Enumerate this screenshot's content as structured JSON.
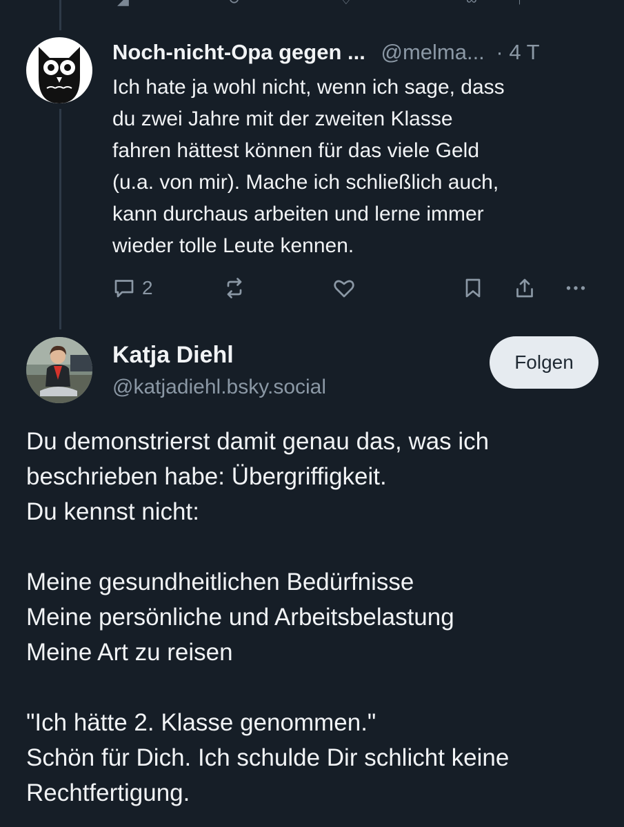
{
  "reply": {
    "author_name": "Noch-nicht-Opa gegen ...",
    "handle": "@melma...",
    "time": "· 4 T",
    "lines": [
      "Ich hate ja wohl nicht, wenn ich sage, dass",
      "du zwei Jahre mit der zweiten Klasse",
      "fahren hättest können für das viele Geld",
      "(u.a. von mir). Mache ich schließlich auch,",
      "kann durchaus arbeiten und lerne immer",
      "wieder tolle Leute kennen."
    ],
    "reply_count": "2",
    "avatar_icon": "owl-avatar"
  },
  "post": {
    "author_name": "Katja Diehl",
    "handle": "@katjadiehl.bsky.social",
    "follow_label": "Folgen",
    "lines": [
      "Du demonstrierst damit genau das, was ich",
      "beschrieben habe: Übergriffigkeit.",
      "Du kennst nicht:",
      "",
      "Meine gesundheitlichen Bedürfnisse",
      "Meine persönliche und Arbeitsbelastung",
      "Meine Art zu reisen",
      "",
      "\"Ich hätte 2. Klasse genommen.\"",
      "Schön für Dich. Ich schulde Dir schlicht keine",
      "Rechtfertigung."
    ]
  },
  "colors": {
    "background": "#161e27",
    "text": "#f1f3f5",
    "muted": "#8b98a5",
    "follow_button": "#e6ebf0"
  }
}
